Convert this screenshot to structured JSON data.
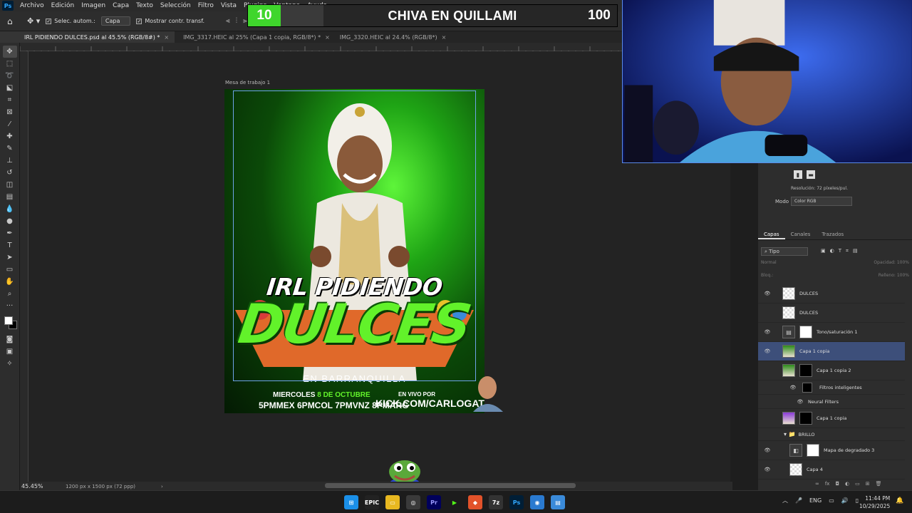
{
  "menu": {
    "items": [
      "Archivo",
      "Edición",
      "Imagen",
      "Capa",
      "Texto",
      "Selección",
      "Filtro",
      "Vista",
      "Plugins",
      "Ventana",
      "Ayuda"
    ]
  },
  "options_bar": {
    "auto_select_label": "Selec. autom.:",
    "auto_select_value": "Capa",
    "transform_label": "Mostrar contr. transf."
  },
  "overlay": {
    "left_number": "10",
    "title": "CHIVA EN QUILLAMI",
    "right_number": "100"
  },
  "tabs": [
    {
      "label": "IRL PIDIENDO DULCES.psd al 45.5% (RGB/8#) *",
      "active": true
    },
    {
      "label": "IMG_3317.HEIC al 25% (Capa 1 copia, RGB/8*) *",
      "active": false
    },
    {
      "label": "IMG_3320.HEIC al 24.4% (RGB/8*)",
      "active": false
    }
  ],
  "canvas": {
    "artboard_label": "Mesa de trabajo 1"
  },
  "poster": {
    "line1": "IRL PIDIENDO",
    "line2": "DULCES",
    "city": "EN BARRANQUILLA",
    "date_prefix": "MIERCOLES ",
    "date_highlight": "8 DE OCTUBRE",
    "times": "5PMMEX 6PMCOL 7PMVNZ 8PMARG",
    "live_label": "EN VIVO POR",
    "url": "KICK.COM/CARLOGATO"
  },
  "status": {
    "zoom": "45.45%",
    "doc_info": "1200 px x 1500 px (72 ppp)"
  },
  "properties": {
    "resolution": "Resolución: 72 píxeles/pul.",
    "mode_label": "Modo",
    "mode_value": "Color RGB"
  },
  "layers_panel": {
    "tabs": [
      "Capas",
      "Canales",
      "Trazados"
    ],
    "filter_value": "Tipo",
    "blend_mode": "Normal",
    "opacity_label": "Opacidad:",
    "opacity_value": "100%",
    "lock_label": "Bloq.:",
    "fill_label": "Relleno:",
    "fill_value": "100%",
    "layers": [
      {
        "name": "DULCES",
        "visible": true,
        "selected": false
      },
      {
        "name": "DULCES",
        "visible": false,
        "selected": false
      },
      {
        "name": "Tono/saturación 1",
        "visible": true,
        "selected": false
      },
      {
        "name": "Capa 1 copia",
        "visible": true,
        "selected": true
      },
      {
        "name": "Capa 1 copia 2",
        "visible": false,
        "selected": false
      },
      {
        "name": "Filtros inteligentes",
        "visible": true,
        "selected": false
      },
      {
        "name": "Neural Filters",
        "visible": true,
        "selected": false
      },
      {
        "name": "Capa 1 copia",
        "visible": false,
        "selected": false
      },
      {
        "name": "BRILLO",
        "visible": false,
        "selected": false
      },
      {
        "name": "Mapa de degradado 3",
        "visible": true,
        "selected": false
      },
      {
        "name": "Capa 4",
        "visible": true,
        "selected": false
      }
    ]
  },
  "taskbar": {
    "language": "ENG",
    "time": "11:44 PM",
    "date": "10/29/2025"
  },
  "colors": {
    "overlay_green": "#3fd62c",
    "poster_green": "#62f22a",
    "selected_layer": "#3d4f7a",
    "webcam_bg": "#0e1a6e"
  }
}
